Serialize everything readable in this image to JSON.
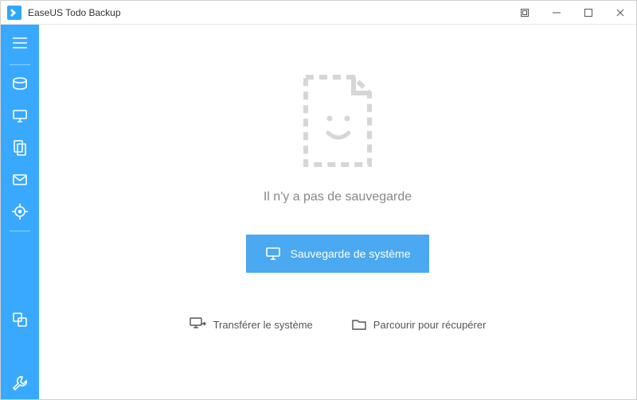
{
  "app": {
    "title": "EaseUS Todo Backup"
  },
  "sidebar": {
    "icons": {
      "menu": "menu",
      "disk": "disk-backup",
      "system": "system-backup",
      "file": "file-backup",
      "mail": "mail-backup",
      "smart": "smart-backup",
      "clone": "clone",
      "apps": "apps",
      "tools": "tools"
    }
  },
  "main": {
    "empty_state_text": "Il n'y a pas de sauvegarde",
    "primary_button_label": "Sauvegarde de système",
    "transfer_label": "Transférer le système",
    "browse_label": "Parcourir pour récupérer"
  }
}
